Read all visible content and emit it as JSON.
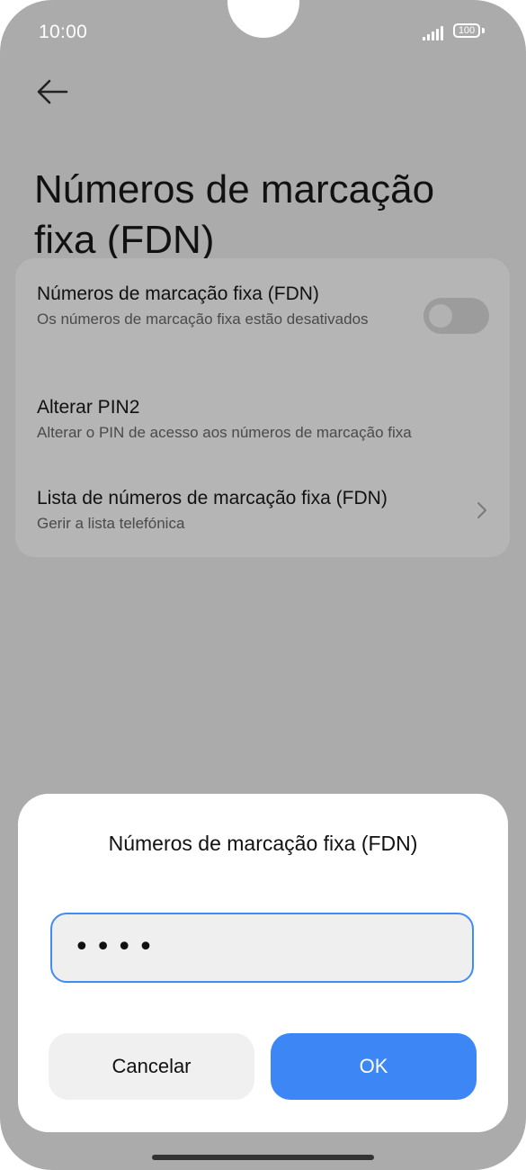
{
  "status_bar": {
    "time": "10:00",
    "battery": "100"
  },
  "page": {
    "title": "Números de marcação fixa (FDN)"
  },
  "settings": {
    "items": [
      {
        "title": "Números de marcação fixa (FDN)",
        "subtitle": "Os números de marcação fixa estão desativados",
        "control": "toggle",
        "toggle_on": false
      },
      {
        "title": "Alterar PIN2",
        "subtitle": "Alterar o PIN de acesso aos números de marcação fixa"
      },
      {
        "title": "Lista de números de marcação fixa (FDN)",
        "subtitle": "Gerir a lista telefónica",
        "control": "chevron-right-icon"
      }
    ]
  },
  "dialog": {
    "title": "Números de marcação fixa (FDN)",
    "pin_value": "••••",
    "cancel_label": "Cancelar",
    "ok_label": "OK"
  },
  "colors": {
    "accent": "#3c86f6",
    "scrim": "#ababab"
  }
}
